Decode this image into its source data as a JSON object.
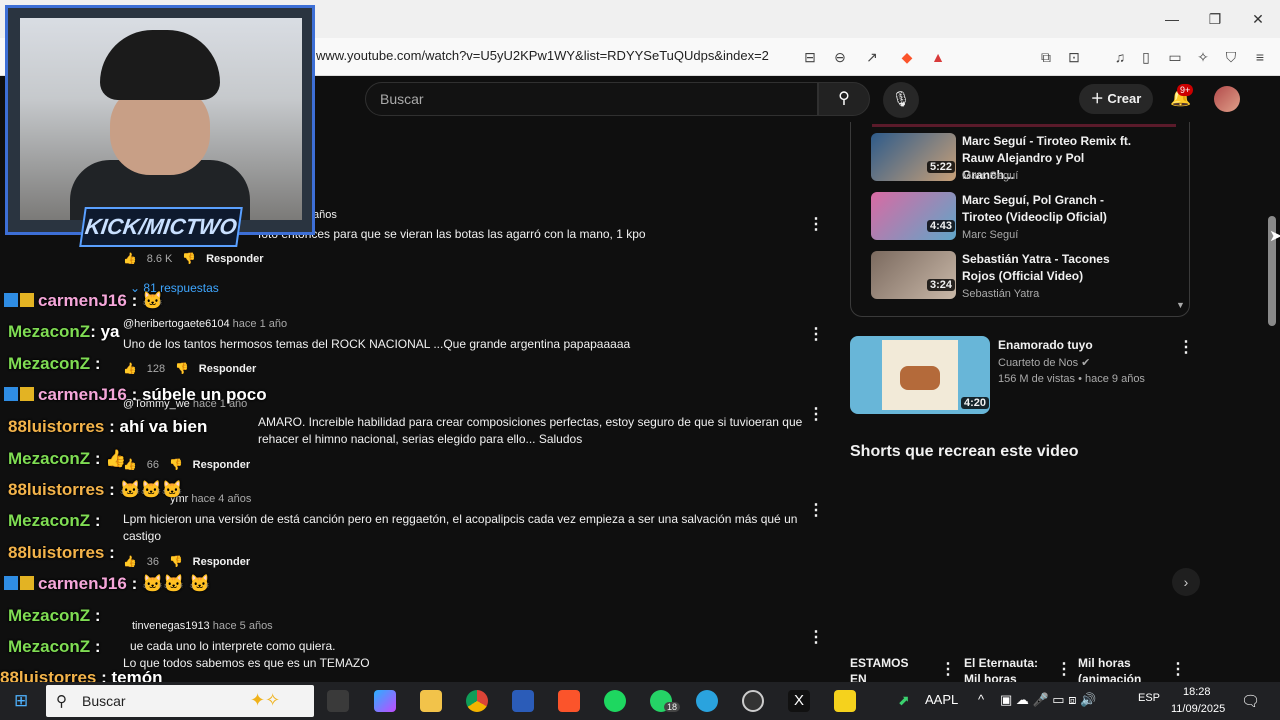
{
  "browser": {
    "url": "www.youtube.com/watch?v=U5yU2KPw1WY&list=RDYYSeTuQUdps&index=2"
  },
  "header": {
    "search_placeholder": "Buscar",
    "create_label": "Crear",
    "notifications_badge": "9+"
  },
  "overlay": {
    "stream_label": "KICK/MICTWO"
  },
  "comments": [
    {
      "age": "años",
      "text": "foto entonces para que se vieran las botas las agarró con la mano, 1 kpo",
      "likes": "8.6 K",
      "reply": "Responder",
      "replies": "81 respuestas"
    },
    {
      "handle": "@heribertogaete6104",
      "age": "hace 1 año",
      "text": "Uno de los tantos hermosos temas del ROCK NACIONAL ...Que grande argentina papapaaaaa",
      "likes": "128",
      "reply": "Responder"
    },
    {
      "handle": "@Tommy_we",
      "age": "hace 1 año",
      "text": "AMARO. Increible habilidad para crear composiciones perfectas, estoy seguro de que si tuvioeran que rehacer el himno nacional, serias elegido para ello... Saludos",
      "likes": "66",
      "reply": "Responder"
    },
    {
      "handle": "ymr",
      "age": "hace 4 años",
      "text": "Lpm hicieron una versión de está canción pero en reggaetón, el acopalipcis cada vez empieza a ser una salvación más qué un castigo",
      "likes": "36",
      "reply": "Responder"
    },
    {
      "handle": "tinvenegas1913",
      "age": "hace 5 años",
      "text1": "ue cada uno lo interprete como quiera.",
      "text2": "Lo que todos sabemos es que es un TEMAZO"
    }
  ],
  "chat": [
    {
      "user": "carmenJ16",
      "msg": ":"
    },
    {
      "user": "MezaconZ",
      "msg": ": ya"
    },
    {
      "user": "MezaconZ",
      "msg": ":"
    },
    {
      "user": "carmenJ16",
      "msg": ": súbele un poco"
    },
    {
      "user": "88luistorres",
      "msg": ": ahí va bien"
    },
    {
      "user": "MezaconZ",
      "msg": ":"
    },
    {
      "user": "88luistorres",
      "msg": ":"
    },
    {
      "user": "MezaconZ",
      "msg": ":"
    },
    {
      "user": "88luistorres",
      "msg": ":"
    },
    {
      "user": "carmenJ16",
      "msg": ":"
    },
    {
      "user": "MezaconZ",
      "msg": ":"
    },
    {
      "user": "MezaconZ",
      "msg": ":"
    },
    {
      "user": "88luistorres",
      "msg": ": temón"
    }
  ],
  "playlist": [
    {
      "title": "Marc Seguí - Tiroteo Remix ft. Rauw Alejandro y Pol Granch...",
      "channel": "Marc Seguí",
      "duration": "5:22"
    },
    {
      "title": "Marc Seguí, Pol Granch - Tiroteo (Videoclip Oficial)",
      "channel": "Marc Seguí",
      "duration": "4:43"
    },
    {
      "title": "Sebastián Yatra - Tacones Rojos (Official Video)",
      "channel": "Sebastián Yatra",
      "duration": "3:24"
    }
  ],
  "recommended": {
    "title": "Enamorado tuyo",
    "channel": "Cuarteto de Nos",
    "meta": "156 M de vistas • hace 9 años",
    "duration": "4:20"
  },
  "shorts_heading": "Shorts que recrean este video",
  "bottom_cards": [
    {
      "text": "ESTAMOS EN"
    },
    {
      "text": "El Eternauta: Mil horas"
    },
    {
      "text": "Mil horas (animación"
    }
  ],
  "taskbar": {
    "search": "Buscar",
    "stock": "AAPL",
    "lang": "ESP",
    "time": "18:28",
    "date": "11/09/2025",
    "whatsapp_badge": "18"
  }
}
